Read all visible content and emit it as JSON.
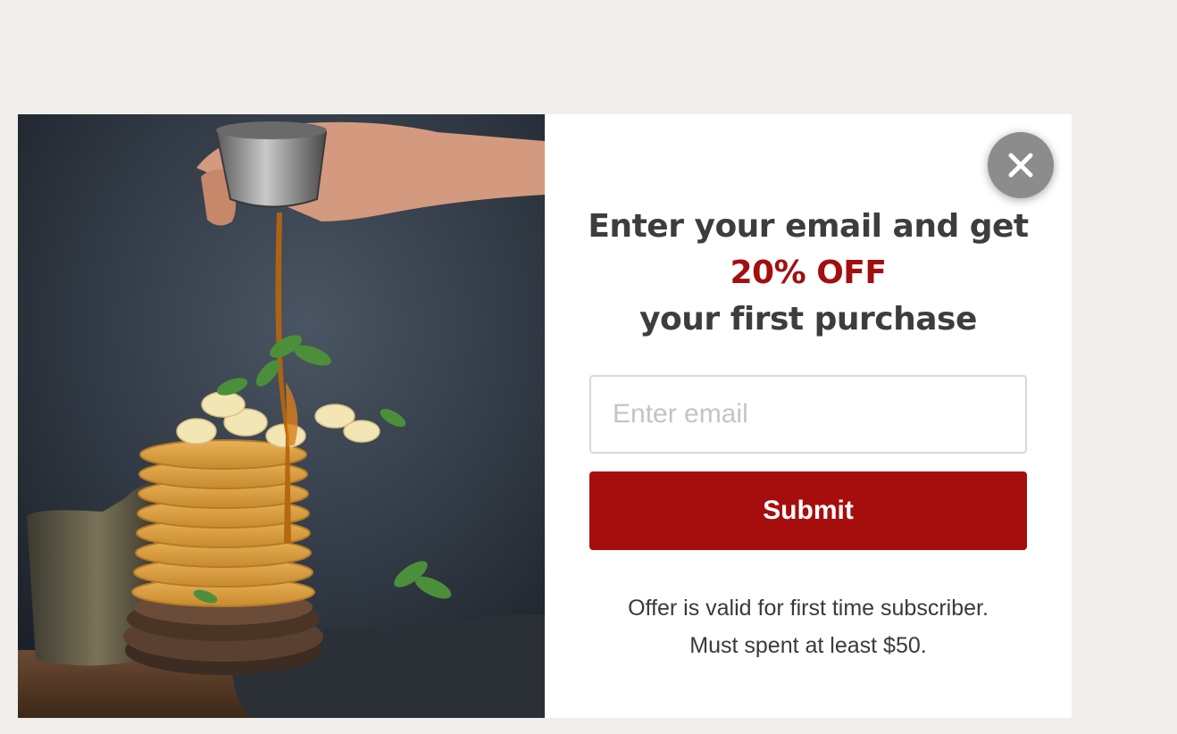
{
  "modal": {
    "image": {
      "alt": "pancake-stack-photo"
    },
    "close": {
      "icon": "close-icon"
    },
    "headline": {
      "line1": "Enter your email and get",
      "accent": "20% OFF",
      "line3": "your first purchase"
    },
    "form": {
      "email_value": "",
      "email_placeholder": "Enter email",
      "submit_label": "Submit"
    },
    "disclaimer": {
      "line1": "Offer is valid for first time subscriber.",
      "line2": "Must spent at least $50."
    },
    "colors": {
      "accent": "#a30e0e",
      "button": "#a60d0d",
      "background": "#efeeea"
    }
  }
}
